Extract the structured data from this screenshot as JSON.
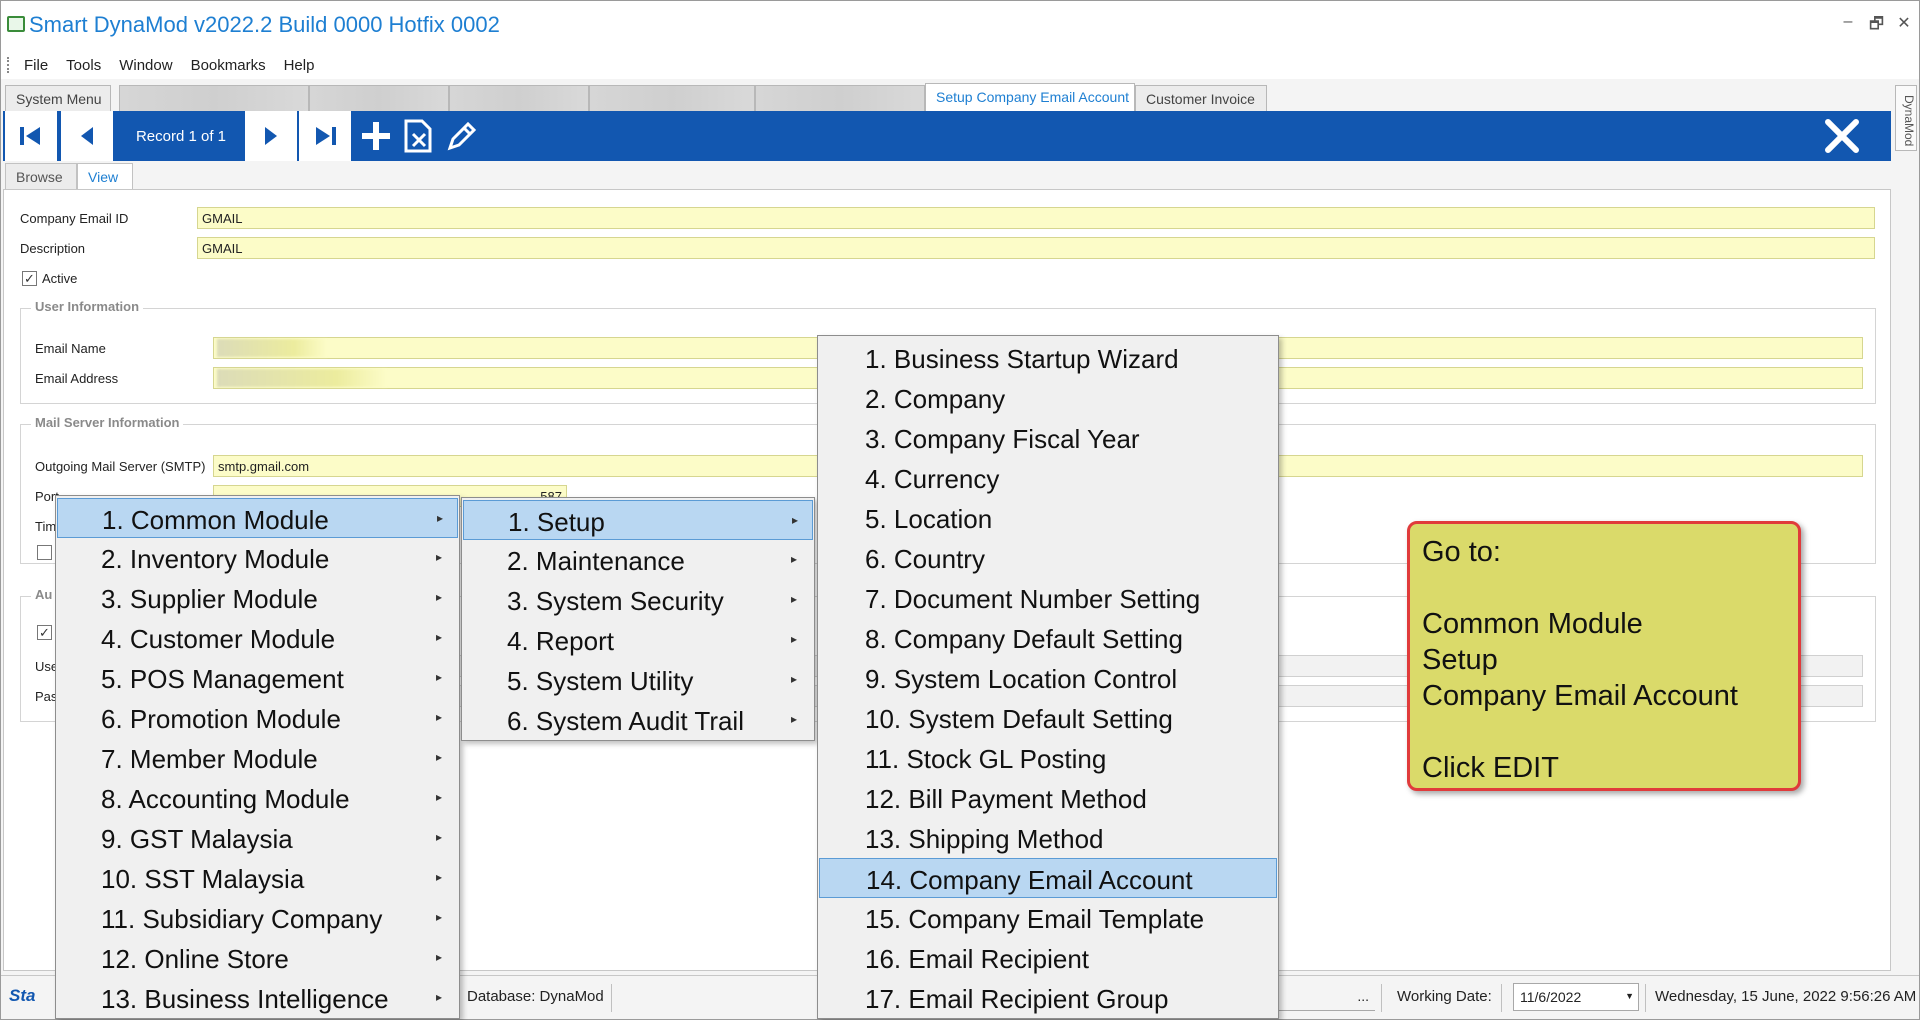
{
  "window": {
    "title": "Smart DynaMod v2022.2 Build 0000 Hotfix 0002",
    "controls": [
      "–",
      "🗗",
      "✕"
    ]
  },
  "menubar": [
    "File",
    "Tools",
    "Window",
    "Bookmarks",
    "Help"
  ],
  "tabs": {
    "system_menu": "System Menu",
    "setup_company_email": "Setup Company Email Account",
    "customer_invoice": "Customer Invoice"
  },
  "toolbar": {
    "record_label": "Record 1 of 1"
  },
  "side_strip": "DynaMod",
  "subtabs": [
    "Browse",
    "View"
  ],
  "form": {
    "company_email_id_label": "Company Email ID",
    "company_email_id_value": "GMAIL",
    "description_label": "Description",
    "description_value": "GMAIL",
    "active_label": "Active",
    "user_info_title": "User Information",
    "email_name_label": "Email Name",
    "email_address_label": "Email Address",
    "mail_server_title": "Mail Server Information",
    "outgoing_label": "Outgoing Mail Server (SMTP)",
    "outgoing_value": "smtp.gmail.com",
    "port_label": "Port",
    "port_value": "587",
    "timeout_label_partial": "Tim",
    "auth_title_partial": "Au",
    "user_label_partial": "Use",
    "pass_label_partial": "Pas"
  },
  "menu_level1": [
    "1. Common Module",
    "2. Inventory Module",
    "3. Supplier Module",
    "4. Customer Module",
    "5. POS Management",
    "6. Promotion Module",
    "7. Member Module",
    "8. Accounting Module",
    "9. GST Malaysia",
    "10. SST Malaysia",
    "11. Subsidiary Company",
    "12. Online Store",
    "13. Business Intelligence"
  ],
  "menu_level2": [
    "1. Setup",
    "2. Maintenance",
    "3. System Security",
    "4. Report",
    "5. System Utility",
    "6. System Audit Trail"
  ],
  "menu_level3": [
    "1. Business Startup Wizard",
    "2. Company",
    "3. Company Fiscal Year",
    "4. Currency",
    "5. Location",
    "6. Country",
    "7. Document Number Setting",
    "8. Company Default Setting",
    "9. System Location Control",
    "10. System Default Setting",
    "11. Stock GL Posting",
    "12. Bill Payment Method",
    "13. Shipping Method",
    "14. Company Email Account",
    "15. Company Email Template",
    "16. Email Recipient",
    "17. Email Recipient Group"
  ],
  "callout": {
    "line1": "Go to:",
    "line2": "Common Module",
    "line3": "Setup",
    "line4": "Company Email Account",
    "line5": "Click EDIT"
  },
  "statusbar": {
    "database": "Database: DynaMod",
    "ellipsis": "...",
    "working_date_label": "Working Date:",
    "working_date_value": "11/6/2022",
    "datetime": "Wednesday, 15 June, 2022 9:56:26 AM",
    "logo_text": "Sta"
  },
  "colors": {
    "toolbar_blue": "#1257b0",
    "title_blue": "#1e7fd2",
    "field_yellow": "#fcfcc8",
    "selection_blue": "#b9d7f2",
    "callout_fill": "#dada6a",
    "callout_border": "#e03b3b"
  }
}
